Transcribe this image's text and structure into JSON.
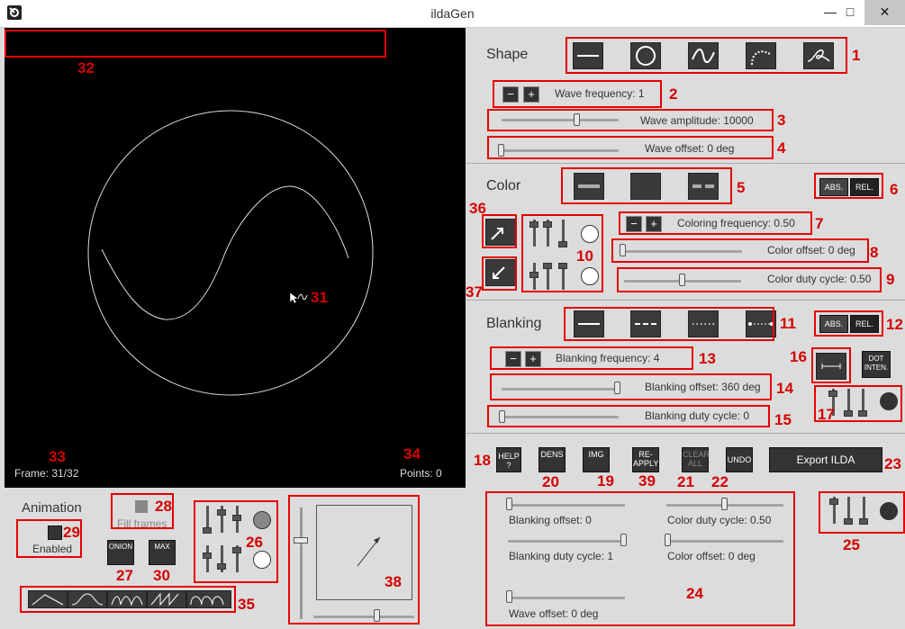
{
  "window": {
    "title": "ildaGen",
    "minimize": "—",
    "maximize": "□",
    "close": "✕"
  },
  "canvas": {
    "frame": "Frame: 31/32",
    "points": "Points: 0"
  },
  "shape": {
    "title": "Shape",
    "wave_frequency": "Wave frequency: 1",
    "wave_amplitude": "Wave amplitude: 10000",
    "wave_offset": "Wave offset: 0 deg",
    "wave_amplitude_level": 0.62,
    "wave_offset_level": 0.0
  },
  "color": {
    "title": "Color",
    "abs": "ABS.",
    "rel": "REL.",
    "coloring_frequency": "Coloring frequency: 0.50",
    "color_offset": "Color offset: 0 deg",
    "color_duty_cycle": "Color duty cycle: 0.50"
  },
  "blanking": {
    "title": "Blanking",
    "abs": "ABS.",
    "rel": "REL.",
    "frequency": "Blanking frequency: 4",
    "offset": "Blanking offset: 360 deg",
    "duty_cycle": "Blanking duty cycle: 0",
    "dot_inten": "DOT INTEN."
  },
  "toolbar": {
    "help": "HELP ?",
    "dens": "DENS",
    "img": "IMG",
    "reapply": "RE-APPLY",
    "clear_all": "CLEAR ALL",
    "undo": "UNDO",
    "export": "Export ILDA"
  },
  "animation": {
    "title": "Animation",
    "enabled": "Enabled",
    "fill_frames": "Fill frames",
    "onion": "ONION",
    "max": "MAX"
  },
  "anim_params": {
    "blanking_offset": "Blanking offset: 0",
    "blanking_duty_cycle": "Blanking duty cycle: 1",
    "wave_offset": "Wave offset: 0 deg",
    "color_duty_cycle": "Color duty cycle: 0.50",
    "color_offset": "Color offset: 0 deg"
  },
  "markers": [
    "1",
    "2",
    "3",
    "4",
    "5",
    "6",
    "7",
    "8",
    "9",
    "10",
    "11",
    "12",
    "13",
    "14",
    "15",
    "16",
    "17",
    "18",
    "19",
    "20",
    "21",
    "22",
    "23",
    "24",
    "25",
    "26",
    "27",
    "28",
    "29",
    "30",
    "31",
    "32",
    "33",
    "34",
    "35",
    "36",
    "37",
    "38",
    "39"
  ],
  "colors": {
    "accent": "#e60000",
    "dark_button": "#333333",
    "panel": "#dcdcdc"
  }
}
